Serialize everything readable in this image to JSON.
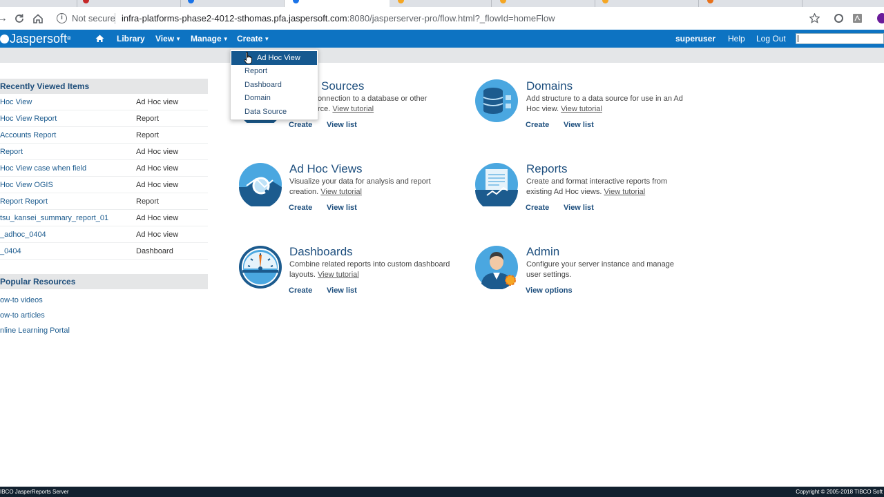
{
  "browser": {
    "not_secure": "Not secure",
    "url_host": "infra-platforms-phase2-4012-sthomas.pfa.jaspersoft.com",
    "url_path": ":8080/jasperserver-pro/flow.html?_flowId=homeFlow"
  },
  "header": {
    "logo": "Jaspersoft",
    "menu": {
      "library": "Library",
      "view": "View",
      "manage": "Manage",
      "create": "Create"
    },
    "user": "superuser",
    "help": "Help",
    "logout": "Log Out"
  },
  "create_menu": {
    "items": [
      "Ad Hoc View",
      "Report",
      "Dashboard",
      "Domain",
      "Data Source"
    ],
    "highlighted": "Ad Hoc View"
  },
  "recently_viewed": {
    "title": "Recently Viewed Items",
    "items": [
      {
        "name": "Hoc View",
        "type": "Ad Hoc view"
      },
      {
        "name": "Hoc View Report",
        "type": "Report"
      },
      {
        "name": "Accounts Report",
        "type": "Report"
      },
      {
        "name": "Report",
        "type": "Ad Hoc view"
      },
      {
        "name": "Hoc View case when field",
        "type": "Ad Hoc view"
      },
      {
        "name": "Hoc View OGIS",
        "type": "Ad Hoc view"
      },
      {
        "name": "Report Report",
        "type": "Report"
      },
      {
        "name": "tsu_kansei_summary_report_01",
        "type": "Ad Hoc view"
      },
      {
        "name": "_adhoc_0404",
        "type": "Ad Hoc view"
      },
      {
        "name": "_0404",
        "type": "Dashboard"
      }
    ]
  },
  "popular": {
    "title": "Popular Resources",
    "links": [
      "ow-to videos",
      "ow-to articles",
      "nline Learning Portal"
    ]
  },
  "tiles": {
    "data_sources": {
      "title": "Sources",
      "desc": "onnection to a database or other",
      "desc2": "rce.",
      "tutorial": "View tutorial",
      "create": "Create",
      "view_list": "View list"
    },
    "domains": {
      "title": "Domains",
      "desc": "Add structure to a data source for use in an Ad Hoc view.",
      "tutorial": "View tutorial",
      "create": "Create",
      "view_list": "View list"
    },
    "adhoc": {
      "title": "Ad Hoc Views",
      "desc": "Visualize your data for analysis and report creation.",
      "tutorial": "View tutorial",
      "create": "Create",
      "view_list": "View list"
    },
    "reports": {
      "title": "Reports",
      "desc": "Create and format interactive reports from existing Ad Hoc views.",
      "tutorial": "View tutorial",
      "create": "Create",
      "view_list": "View list"
    },
    "dashboards": {
      "title": "Dashboards",
      "desc": "Combine related reports into custom dashboard layouts.",
      "tutorial": "View tutorial",
      "create": "Create",
      "view_list": "View list"
    },
    "admin": {
      "title": "Admin",
      "desc": "Configure your server instance and manage user settings.",
      "view_options": "View options"
    }
  },
  "footer": {
    "left": "IBCO JasperReports Server",
    "right": "Copyright © 2005-2018 TIBCO Soft"
  },
  "colors": {
    "header_blue": "#0d73c2",
    "menu_highlight": "#15588f",
    "title_blue": "#1e4f7e",
    "icon_blue": "#4aa7e0",
    "footer": "#12212f"
  },
  "icons": [
    "back-icon",
    "reload-icon",
    "home-icon",
    "info-icon",
    "star-icon",
    "extension-icon",
    "pdf-icon"
  ]
}
